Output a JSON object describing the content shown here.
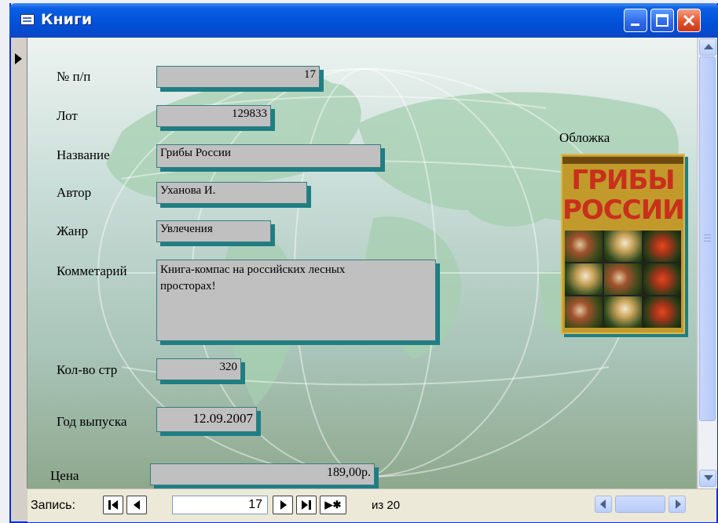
{
  "window": {
    "title": "Книги"
  },
  "title_buttons": {
    "minimize": "minimize-icon",
    "maximize": "maximize-icon",
    "close": "close-icon"
  },
  "form": {
    "fields": [
      {
        "label": "№ п/п",
        "value": "17"
      },
      {
        "label": "Лот",
        "value": "129833"
      },
      {
        "label": "Название",
        "value": "Грибы России"
      },
      {
        "label": "Автор",
        "value": "Уханова И."
      },
      {
        "label": "Жанр",
        "value": "Увлечения"
      },
      {
        "label": "Комметарий",
        "value": "Книга-компас на российских лесных просторах!"
      },
      {
        "label": "Кол-во стр",
        "value": "320"
      },
      {
        "label": "Год выпуска",
        "value": "12.09.2007"
      },
      {
        "label": "Цена",
        "value": "189,00р."
      }
    ],
    "cover": {
      "label": "Обложка",
      "title_line1": "ГРИБЫ",
      "title_line2": "РОССИИ"
    }
  },
  "navigation": {
    "record_label": "Запись:",
    "current_record": "17",
    "of_label": "из 20",
    "new_record_glyph": "▶✱"
  },
  "colors": {
    "titlebar": "#0050d8",
    "field_bg": "#c0c0c0",
    "field_shadow": "#1f7e83",
    "map_land": "#9fc8a8"
  }
}
